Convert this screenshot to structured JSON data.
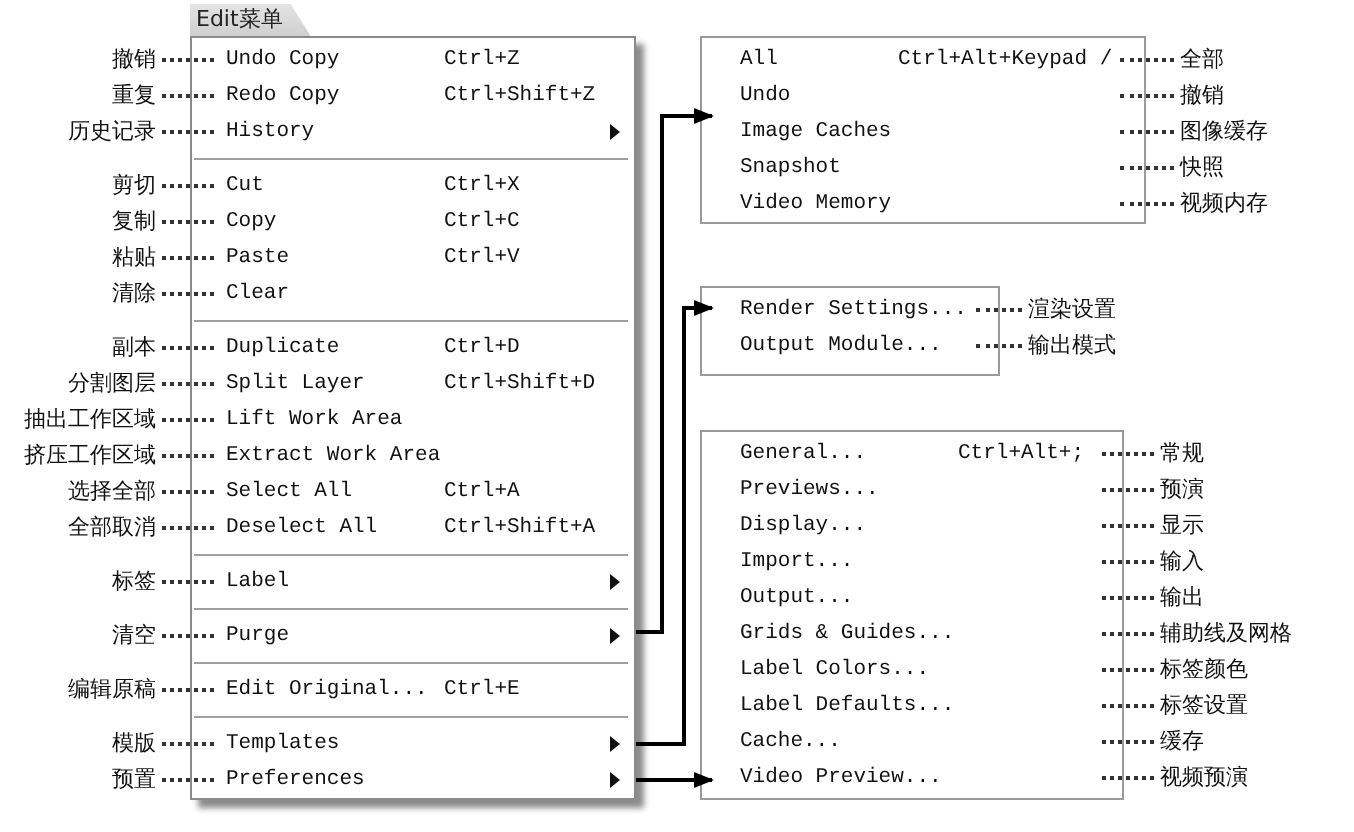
{
  "menu": {
    "title": "Edit菜单",
    "groups": [
      [
        {
          "label": "Undo Copy",
          "shortcut": "Ctrl+Z",
          "submenu": false,
          "annotation": "撤销"
        },
        {
          "label": "Redo Copy",
          "shortcut": "Ctrl+Shift+Z",
          "submenu": false,
          "annotation": "重复"
        },
        {
          "label": "History",
          "submenu": true,
          "annotation": "历史记录"
        }
      ],
      [
        {
          "label": "Cut",
          "shortcut": "Ctrl+X",
          "submenu": false,
          "annotation": "剪切"
        },
        {
          "label": "Copy",
          "shortcut": "Ctrl+C",
          "submenu": false,
          "annotation": "复制"
        },
        {
          "label": "Paste",
          "shortcut": "Ctrl+V",
          "submenu": false,
          "annotation": "粘贴"
        },
        {
          "label": "Clear",
          "submenu": false,
          "annotation": "清除"
        }
      ],
      [
        {
          "label": "Duplicate",
          "shortcut": "Ctrl+D",
          "submenu": false,
          "annotation": "副本"
        },
        {
          "label": "Split Layer",
          "shortcut": "Ctrl+Shift+D",
          "submenu": false,
          "annotation": "分割图层"
        },
        {
          "label": "Lift Work Area",
          "submenu": false,
          "annotation": "抽出工作区域"
        },
        {
          "label": "Extract Work Area",
          "submenu": false,
          "annotation": "挤压工作区域"
        },
        {
          "label": "Select All",
          "shortcut": "Ctrl+A",
          "submenu": false,
          "annotation": "选择全部"
        },
        {
          "label": "Deselect All",
          "shortcut": "Ctrl+Shift+A",
          "submenu": false,
          "annotation": "全部取消"
        }
      ],
      [
        {
          "label": "Label",
          "submenu": true,
          "annotation": "标签"
        }
      ],
      [
        {
          "label": "Purge",
          "submenu": true,
          "annotation": "清空"
        }
      ],
      [
        {
          "label": "Edit Original...",
          "shortcut": "Ctrl+E",
          "submenu": false,
          "annotation": "编辑原稿"
        }
      ],
      [
        {
          "label": "Templates",
          "submenu": true,
          "annotation": "模版"
        },
        {
          "label": "Preferences",
          "submenu": true,
          "annotation": "预置"
        }
      ]
    ]
  },
  "submenus": [
    {
      "items": [
        {
          "label": "All",
          "shortcut": "Ctrl+Alt+Keypad /",
          "annotation": "全部"
        },
        {
          "label": "Undo",
          "annotation": "撤销"
        },
        {
          "label": "Image Caches",
          "annotation": "图像缓存"
        },
        {
          "label": "Snapshot",
          "annotation": "快照"
        },
        {
          "label": "Video Memory",
          "annotation": "视频内存"
        }
      ]
    },
    {
      "items": [
        {
          "label": "Render Settings...",
          "annotation": "渲染设置"
        },
        {
          "label": "Output Module...",
          "annotation": "输出模式"
        }
      ]
    },
    {
      "items": [
        {
          "label": "General...",
          "shortcut": "Ctrl+Alt+;",
          "annotation": "常规"
        },
        {
          "label": "Previews...",
          "annotation": "预演"
        },
        {
          "label": "Display...",
          "annotation": "显示"
        },
        {
          "label": "Import...",
          "annotation": "输入"
        },
        {
          "label": "Output...",
          "annotation": "输出"
        },
        {
          "label": "Grids & Guides...",
          "annotation": "辅助线及网格"
        },
        {
          "label": "Label Colors...",
          "annotation": "标签颜色"
        },
        {
          "label": "Label Defaults...",
          "annotation": "标签设置"
        },
        {
          "label": "Cache...",
          "annotation": "缓存"
        },
        {
          "label": "Video Preview...",
          "annotation": "视频预演"
        }
      ]
    }
  ]
}
